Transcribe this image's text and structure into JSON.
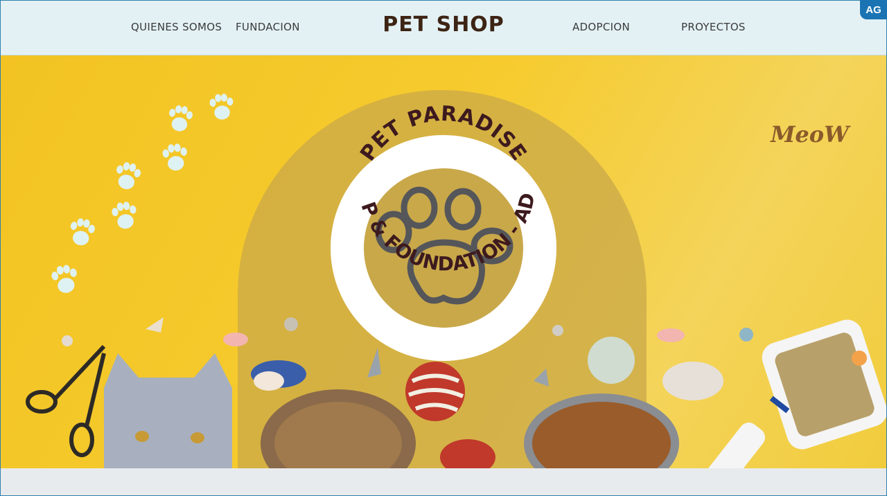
{
  "nav": {
    "left_links": [
      "QUIENES SOMOS",
      "FUNDACION"
    ],
    "brand": "PET SHOP",
    "right_links": [
      "ADOPCION",
      "PROYECTOS"
    ]
  },
  "corner_badge": "AG",
  "hero": {
    "logo_top_text": "PET PARADISE",
    "logo_ring_text": "PET SHOP & FOUNDATION - ADOPTION",
    "meow_text": "MeoW"
  },
  "colors": {
    "nav_bg": "#e3f1f5",
    "hero_yellow": "#f2c322",
    "arch": "#c9a84a",
    "logo_dark": "#3d1a1e",
    "paw_grey": "#55565a",
    "badge": "#1a74b3"
  }
}
